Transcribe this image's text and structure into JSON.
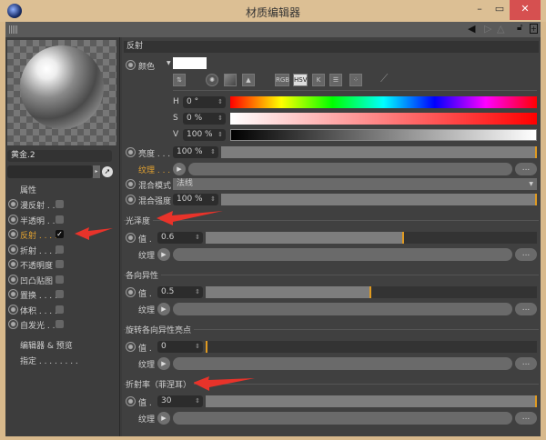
{
  "window": {
    "title": "材质编辑器",
    "minimize": "–",
    "maximize": "▭",
    "close": "✕"
  },
  "left": {
    "material_name": "黄金.2",
    "attributes_label": "属性",
    "channels": [
      {
        "label": "漫反射 . .",
        "checked": false
      },
      {
        "label": "半透明 . .",
        "checked": false
      },
      {
        "label": "反射 . . . .",
        "checked": true,
        "active": true
      },
      {
        "label": "折射 . . . .",
        "checked": false
      },
      {
        "label": "不透明度",
        "checked": false
      },
      {
        "label": "凹凸贴图",
        "checked": false
      },
      {
        "label": "置换 . . . .",
        "checked": false
      },
      {
        "label": "体积 . . . .",
        "checked": false
      },
      {
        "label": "自发光 . .",
        "checked": false
      }
    ],
    "editor_preview": "编辑器 & 预览",
    "assign": "指定 . . . . . . . ."
  },
  "reflection": {
    "header": "反射",
    "color_label": "颜色",
    "color": "#ffffff",
    "modes": [
      "RGB",
      "HSV",
      "K"
    ],
    "h_label": "H",
    "h_value": "0 °",
    "s_label": "S",
    "s_value": "0 %",
    "v_label": "V",
    "v_value": "100 %",
    "brightness_label": "亮度 . . .",
    "brightness_value": "100 %",
    "brightness_fraction": 1.0,
    "texture_label": "纹理 . . .",
    "more": "...",
    "blend_mode_label": "混合模式",
    "blend_mode_value": "法线",
    "blend_strength_label": "混合强度",
    "blend_strength_value": "100 %",
    "blend_strength_fraction": 1.0
  },
  "sections": [
    {
      "title": "光泽度",
      "value_label": "值 .",
      "value": "0.6",
      "fraction": 0.6,
      "texture_label": "纹理"
    },
    {
      "title": "各向异性",
      "value_label": "值 .",
      "value": "0.5",
      "fraction": 0.5,
      "texture_label": "纹理"
    },
    {
      "title": "旋转各向异性亮点",
      "value_label": "值 .",
      "value": "0",
      "fraction": 0,
      "texture_label": "纹理"
    },
    {
      "title": "折射率（菲涅耳）",
      "value_label": "值 .",
      "value": "30",
      "fraction": 1.0,
      "texture_label": "纹理"
    }
  ],
  "colors": {
    "accent": "#e09a20",
    "arrow": "#e8332a",
    "titlebar": "#dcbf94",
    "close": "#d9534f"
  }
}
